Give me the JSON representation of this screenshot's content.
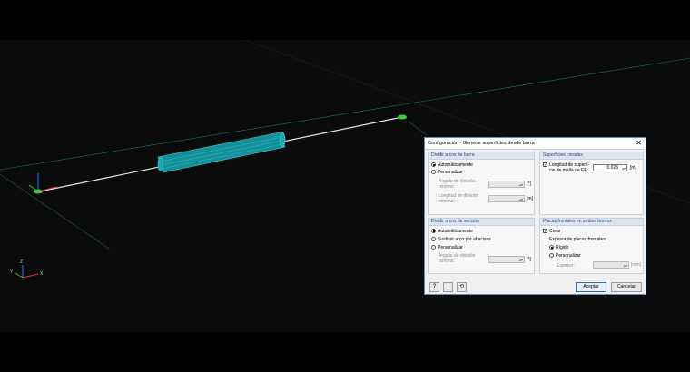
{
  "dialog": {
    "title": "Configuración - Generar superficies desde barra",
    "close_glyph": "✕",
    "divide_bar": {
      "title": "Dividir arcos de barra",
      "option_auto": "Automáticamente",
      "option_custom": "Personalizar",
      "angle_label_1": "Ángulo de división",
      "angle_label_2": "mínimo:",
      "angle_unit": "[°]",
      "length_label_1": "Longitud de división",
      "length_label_2": "mínima:",
      "length_unit": "[m]"
    },
    "surfaces": {
      "title": "Superficies creadas",
      "check_label_1": "Longitud de superfi-",
      "check_label_2": "cie de malla de EF:",
      "mesh_value": "0.025",
      "mesh_unit": "[m]"
    },
    "divide_section": {
      "title": "Dividir arcos de sección",
      "option_auto": "Automáticamente",
      "option_replace": "Sustituir arco por abscisas",
      "option_custom": "Personalizar",
      "angle_label_1": "Ángulo de división",
      "angle_label_2": "mínimo:",
      "angle_unit": "[°]"
    },
    "front_plates": {
      "title": "Placas frontales en ambos bordes",
      "create_label": "Crear",
      "thickness_label": "Espesor de placas frontales:",
      "option_rigid": "Rígido",
      "option_custom": "Personalizar",
      "thickness_field_label": "Espesor:",
      "thickness_unit": "[mm]"
    },
    "footer": {
      "help_icon": "?",
      "info_icon": "i",
      "defaults_icon": "⟲",
      "accept_label": "Aceptar",
      "cancel_label": "Cancelar"
    }
  },
  "viewport": {
    "axis_x": "X",
    "axis_y": "Y",
    "axis_z": "Z",
    "colors": {
      "member": "#e6e6e6",
      "tube": "#1fa7b0",
      "node": "#3ccf3c",
      "grid_line": "#1f8f7f"
    }
  }
}
